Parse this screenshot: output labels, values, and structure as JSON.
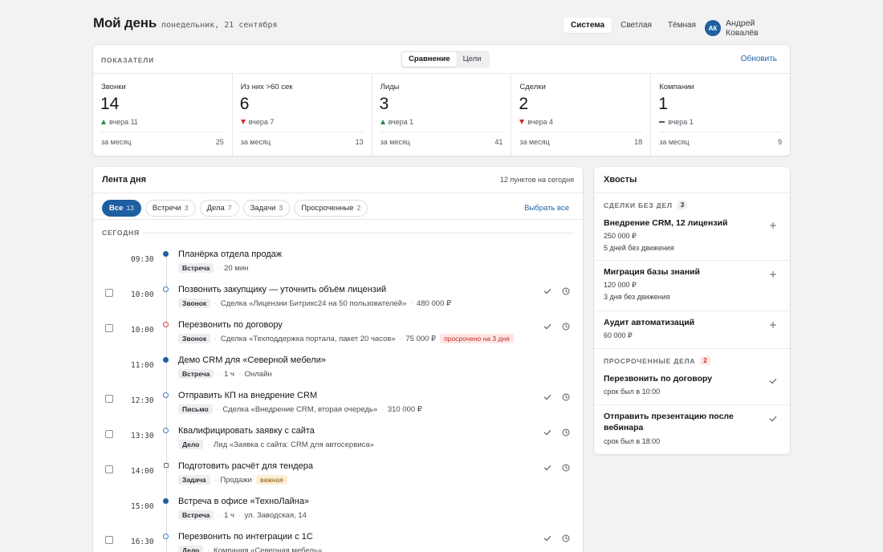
{
  "header": {
    "title": "Мой день",
    "date": "понедельник, 21 сентября",
    "themes": [
      "Система",
      "Светлая",
      "Тёмная"
    ],
    "active_theme": "Система",
    "user": {
      "initials": "АК",
      "name": "Андрей Ковалёв"
    }
  },
  "metrics": {
    "label": "ПОКАЗАТЕЛИ",
    "modes": [
      "Сравнение",
      "Цели"
    ],
    "active_mode": "Сравнение",
    "refresh": "Обновить",
    "month_label": "за месяц",
    "items": [
      {
        "label": "Звонки",
        "value": "14",
        "trend": "up",
        "delta": "вчера 11",
        "month": "25"
      },
      {
        "label": "Из них >60 сек",
        "value": "6",
        "trend": "down",
        "delta": "вчера 7",
        "month": "13"
      },
      {
        "label": "Лиды",
        "value": "3",
        "trend": "up",
        "delta": "вчера 1",
        "month": "41"
      },
      {
        "label": "Сделки",
        "value": "2",
        "trend": "down",
        "delta": "вчера 4",
        "month": "18"
      },
      {
        "label": "Компании",
        "value": "1",
        "trend": "flat",
        "delta": "вчера 1",
        "month": "9"
      }
    ],
    "colors": {
      "up": "#2a8a4a",
      "down": "#d02a2a",
      "accent": "#1e5fa0"
    }
  },
  "feed": {
    "title": "Лента дня",
    "count": "12 пунктов на сегодня",
    "filters": [
      {
        "label": "Все",
        "count": "13",
        "active": true
      },
      {
        "label": "Встречи",
        "count": "3"
      },
      {
        "label": "Дела",
        "count": "7"
      },
      {
        "label": "Задачи",
        "count": "3"
      },
      {
        "label": "Просроченные",
        "count": "2"
      }
    ],
    "select_all": "Выбрать все",
    "section": "СЕГОДНЯ",
    "rows": [
      {
        "time": "09:30",
        "title": "Планёрка отдела продаж",
        "tag": "Встреча",
        "meta": [
          "20 мин"
        ],
        "dot": "filled",
        "checkbox": false
      },
      {
        "time": "10:00",
        "title": "Позвонить закупщику — уточнить объём лицензий",
        "tag": "Звонок",
        "meta": [
          "Сделка «Лицензии Битрикс24 на 50 пользователей»",
          "480 000 ₽"
        ],
        "dot": "open",
        "checkbox": true
      },
      {
        "time": "10:00",
        "title": "Перезвонить по договору",
        "tag": "Звонок",
        "meta": [
          "Сделка «Техподдержка портала, пакет 20 часов»",
          "75 000 ₽"
        ],
        "badge": "просрочено на 3 дня",
        "dot": "red",
        "checkbox": true
      },
      {
        "time": "11:00",
        "title": "Демо CRM для «Северной мебели»",
        "tag": "Встреча",
        "meta": [
          "1 ч",
          "Онлайн"
        ],
        "dot": "filled",
        "checkbox": false
      },
      {
        "time": "12:30",
        "title": "Отправить КП на внедрение CRM",
        "tag": "Письмо",
        "meta": [
          "Сделка «Внедрение CRM, вторая очередь»",
          "310 000 ₽"
        ],
        "dot": "open",
        "checkbox": true
      },
      {
        "time": "13:30",
        "title": "Квалифицировать заявку с сайта",
        "tag": "Дело",
        "meta": [
          "Лид «Заявка с сайта: CRM для автосервиса»"
        ],
        "dot": "open",
        "checkbox": true
      },
      {
        "time": "14:00",
        "title": "Подготовить расчёт для тендера",
        "tag": "Задача",
        "meta": [
          "Продажи"
        ],
        "badge_amber": "важная",
        "dot": "square",
        "checkbox": true
      },
      {
        "time": "15:00",
        "title": "Встреча в офисе «ТехноЛайна»",
        "tag": "Встреча",
        "meta": [
          "1 ч",
          "ул. Заводская, 14"
        ],
        "dot": "filled",
        "checkbox": false
      },
      {
        "time": "16:30",
        "title": "Перезвонить по интеграции с 1С",
        "tag": "Дело",
        "meta": [
          "Компания «Северная мебель»"
        ],
        "dot": "open",
        "checkbox": true
      }
    ]
  },
  "tails": {
    "title": "Хвосты",
    "group1": {
      "label": "СДЕЛКИ БЕЗ ДЕЛ",
      "count": "3"
    },
    "deals": [
      {
        "name": "Внедрение CRM, 12 лицензий",
        "amount": "250 000 ₽",
        "note": "5 дней без движения"
      },
      {
        "name": "Миграция базы знаний",
        "amount": "120 000 ₽",
        "note": "3 дня без движения"
      },
      {
        "name": "Аудит автоматизаций",
        "amount": "60 000 ₽"
      }
    ],
    "group2": {
      "label": "ПРОСРОЧЕННЫЕ ДЕЛА",
      "count": "2"
    },
    "overdue": [
      {
        "name": "Перезвонить по договору",
        "due": "срок был в 10:00"
      },
      {
        "name": "Отправить презентацию после вебинара",
        "due": "срок был в 18:00"
      }
    ]
  }
}
